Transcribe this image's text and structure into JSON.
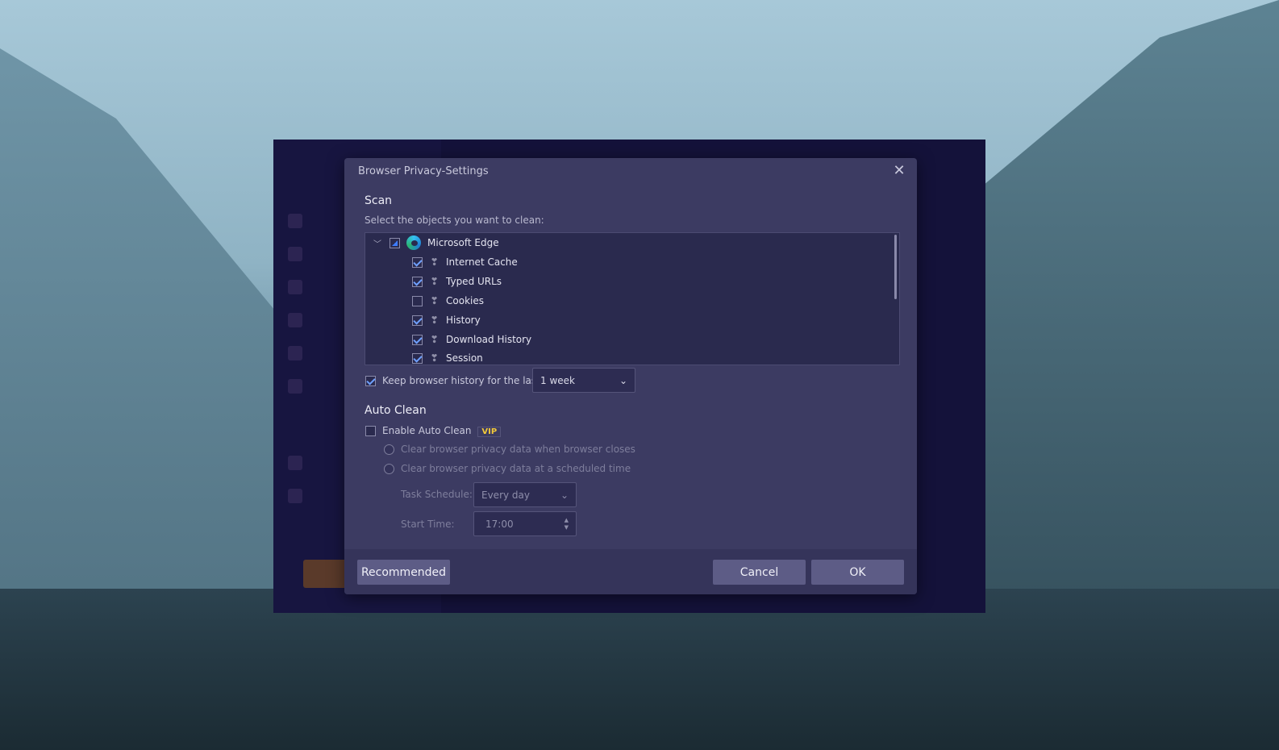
{
  "dialog": {
    "title": "Browser Privacy-Settings",
    "scan": {
      "heading": "Scan",
      "subtitle": "Select the objects you want to clean:",
      "browser": {
        "label": "Microsoft Edge",
        "state": "partial",
        "expanded": true
      },
      "items": [
        {
          "label": "Internet Cache",
          "checked": true
        },
        {
          "label": "Typed URLs",
          "checked": true
        },
        {
          "label": "Cookies",
          "checked": false
        },
        {
          "label": "History",
          "checked": true
        },
        {
          "label": "Download History",
          "checked": true
        },
        {
          "label": "Session",
          "checked": true
        }
      ],
      "keep_history": {
        "label": "Keep browser history for the last",
        "checked": true,
        "value": "1 week"
      }
    },
    "auto_clean": {
      "heading": "Auto Clean",
      "enable_label": "Enable Auto Clean",
      "enabled": false,
      "badge": "VIP",
      "option_close": "Clear browser privacy data when browser closes",
      "option_scheduled": "Clear browser privacy data at a scheduled time",
      "task_schedule_label": "Task Schedule:",
      "task_schedule_value": "Every day",
      "start_time_label": "Start Time:",
      "start_time_value": "17:00"
    },
    "buttons": {
      "recommended": "Recommended",
      "cancel": "Cancel",
      "ok": "OK"
    }
  },
  "colors": {
    "dialog_bg": "#3c3b62",
    "accent": "#3d7cff",
    "vip": "#f1c83a"
  }
}
